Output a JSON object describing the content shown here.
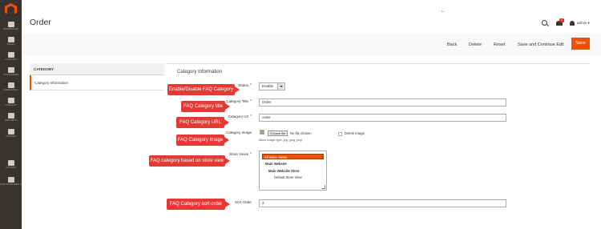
{
  "nav": {
    "items": [
      {
        "label": "Dashboard",
        "icon": "dashboard-icon"
      },
      {
        "label": "Sales",
        "icon": "dollar-icon"
      },
      {
        "label": "Catalog",
        "icon": "cube-icon"
      },
      {
        "label": "Customers",
        "icon": "customers-icon"
      },
      {
        "label": "Marketing",
        "icon": "megaphone-icon"
      },
      {
        "label": "Content",
        "icon": "content-icon"
      },
      {
        "label": "Reports",
        "icon": "bar-chart-icon"
      },
      {
        "label": "Stores",
        "icon": "store-icon"
      },
      {
        "label": "System",
        "icon": "gear-icon"
      },
      {
        "label": "Find Partners & Extensions",
        "icon": "partners-icon"
      }
    ]
  },
  "header": {
    "title": "Order",
    "notifications_count": "4",
    "user_name": "admin"
  },
  "actions": {
    "back": "Back",
    "delete": "Delete",
    "reset": "Reset",
    "save_continue": "Save and Continue Edit",
    "save": "Save"
  },
  "tabs": {
    "heading": "CATEGORY",
    "active_item": "Category Information"
  },
  "form": {
    "section_title": "Category Information",
    "status": {
      "label": "Status",
      "value": "Enable"
    },
    "title": {
      "label": "Category Title",
      "value": "Order"
    },
    "url": {
      "label": "Category Url",
      "value": "order"
    },
    "image": {
      "label": "Category Image",
      "choose_button": "Choose file",
      "no_file": "No file chosen",
      "allowed": "Allow image type: jpg, jpeg, png",
      "delete_label": "Delete Image"
    },
    "store_views": {
      "label": "Store Views",
      "options": [
        "All Store Views",
        "Main Website",
        "Main Website Store",
        "Default Store View"
      ]
    },
    "sort_order": {
      "label": "Sort Order",
      "value": "2"
    }
  },
  "callouts": {
    "enable": "Enable/Disable FAQ Category",
    "title": "FAQ Category title",
    "url": "FAQ Category URL",
    "image": "FAQ Category Image",
    "store": "FAQ category based on store view",
    "sort": "FAQ Category sort order"
  },
  "colors": {
    "accent": "#eb5202",
    "callout": "#e43a36",
    "nav_bg": "#373330"
  }
}
